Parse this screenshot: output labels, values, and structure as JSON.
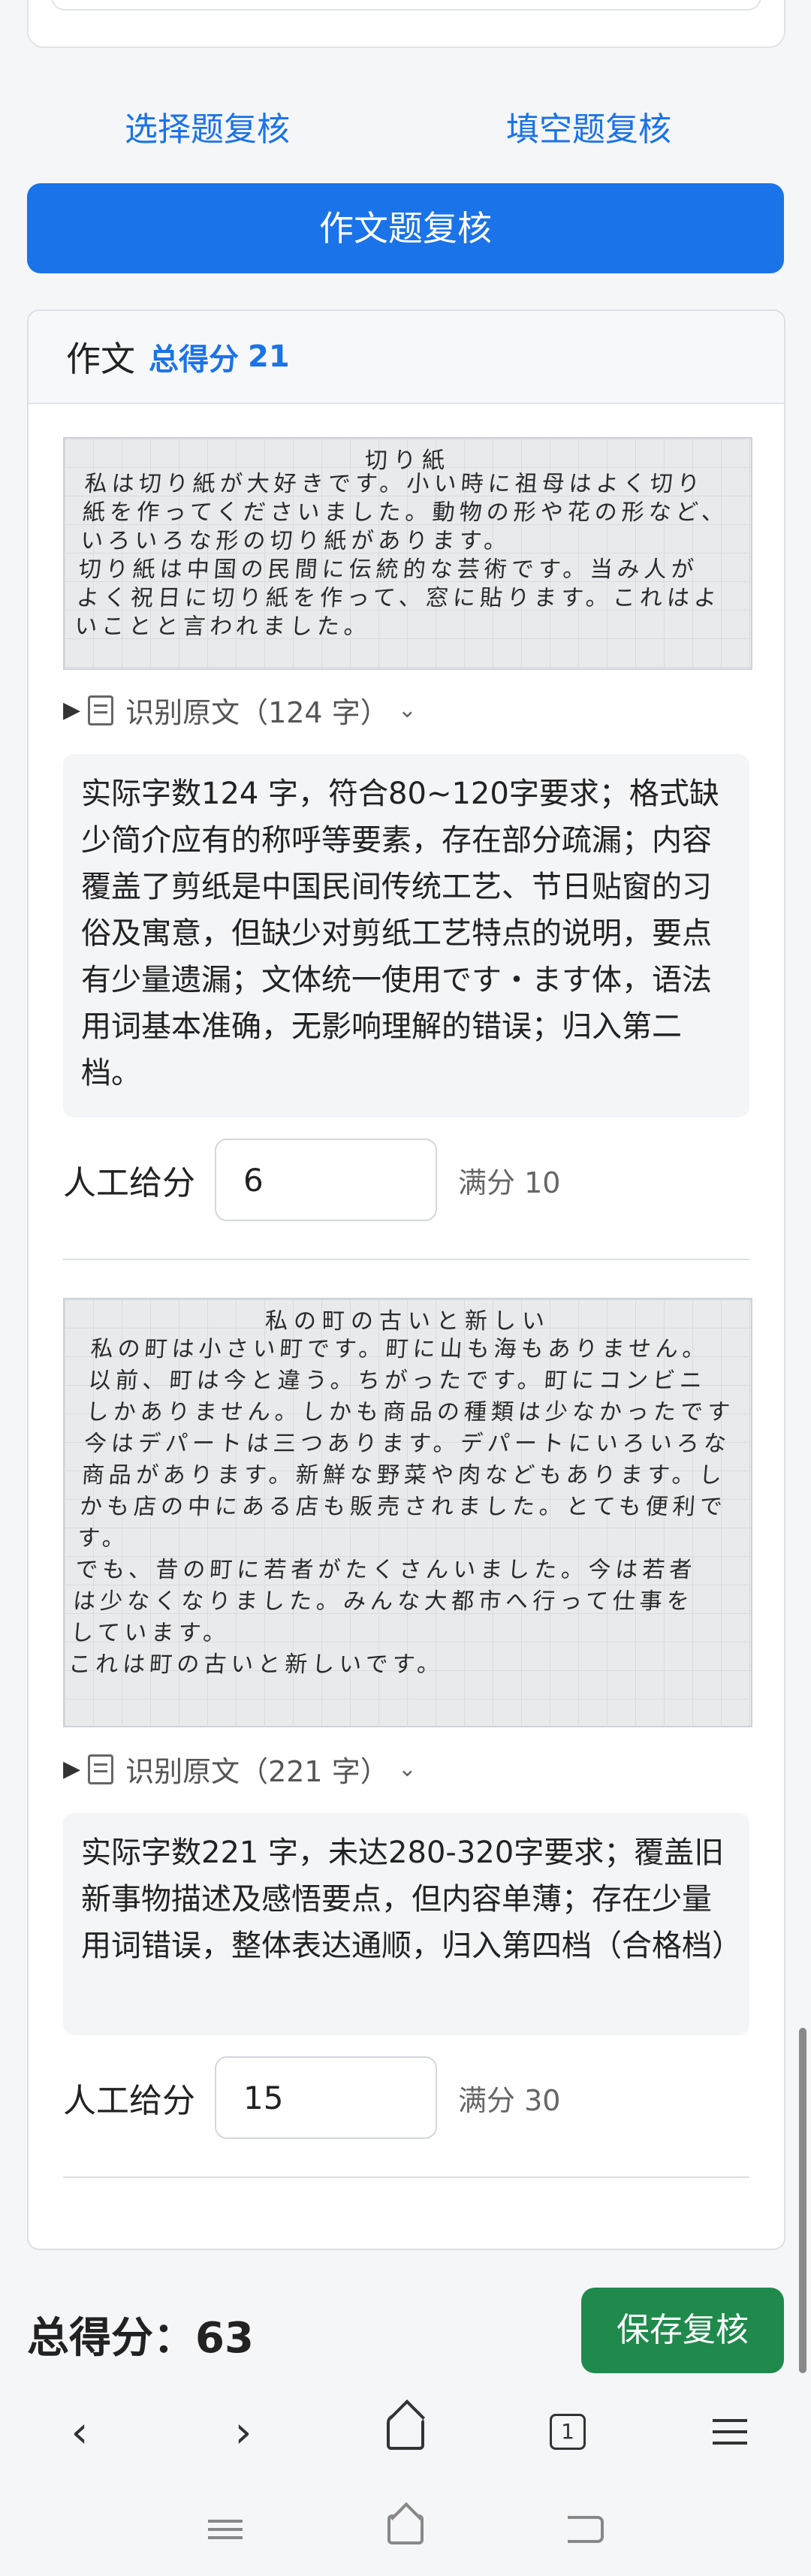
{
  "tabs": {
    "choice_review": "选择题复核",
    "fill_review": "填空题复核",
    "essay_review": "作文题复核"
  },
  "essay": {
    "title": "作文",
    "score_label": "总得分",
    "score_value": "21",
    "items": [
      {
        "image_title": "切り紙",
        "image_lines": [
          "私は切り紙が大好きです。小い時に祖母はよく切り",
          "紙を作ってくださいました。動物の形や花の形など、",
          "いろいろな形の切り紙があります。",
          "切り紙は中国の民間に伝統的な芸術です。当み人が",
          "よく祝日に切り紙を作って、窓に貼ります。これはよ",
          "いことと言われました。"
        ],
        "ocr_toggle": "识别原文（124 字）",
        "feedback": "实际字数124 字，符合80~120字要求；格式缺少简介应有的称呼等要素，存在部分疏漏；内容覆盖了剪纸是中国民间传统工艺、节日贴窗的习俗及寓意，但缺少对剪纸工艺特点的说明，要点有少量遗漏；文体统一使用です・ます体，语法用词基本准确，无影响理解的错误；归入第二档。",
        "score_label": "人工给分",
        "score_value": "6",
        "full_score": "满分 10"
      },
      {
        "image_title": "私の町の古いと新しい",
        "image_lines": [
          "私の町は小さい町です。町に山も海もありません。",
          "以前、町は今と違う。ちがったです。町にコンビニ",
          "しかありません。しかも商品の種類は少なかったです",
          "今はデパートは三つあります。デパートにいろいろな",
          "商品があります。新鮮な野菜や肉などもあります。し",
          "かも店の中にある店も販売されました。とても便利で",
          "す。",
          "でも、昔の町に若者がたくさんいました。今は若者",
          "は少なくなりました。みんな大都市へ行って仕事を",
          "しています。",
          "これは町の古いと新しいです。"
        ],
        "ocr_toggle": "识别原文（221 字）",
        "feedback": "实际字数221 字，未达280-320字要求；覆盖旧新事物描述及感悟要点，但内容单薄；存在少量用词错误，整体表达通顺，归入第四档（合格档）",
        "score_label": "人工给分",
        "score_value": "15",
        "full_score": "满分 30"
      }
    ]
  },
  "footer": {
    "total_label": "总得分：",
    "total_value": "63",
    "save_label": "保存复核"
  },
  "browser": {
    "tab_count": "1"
  }
}
